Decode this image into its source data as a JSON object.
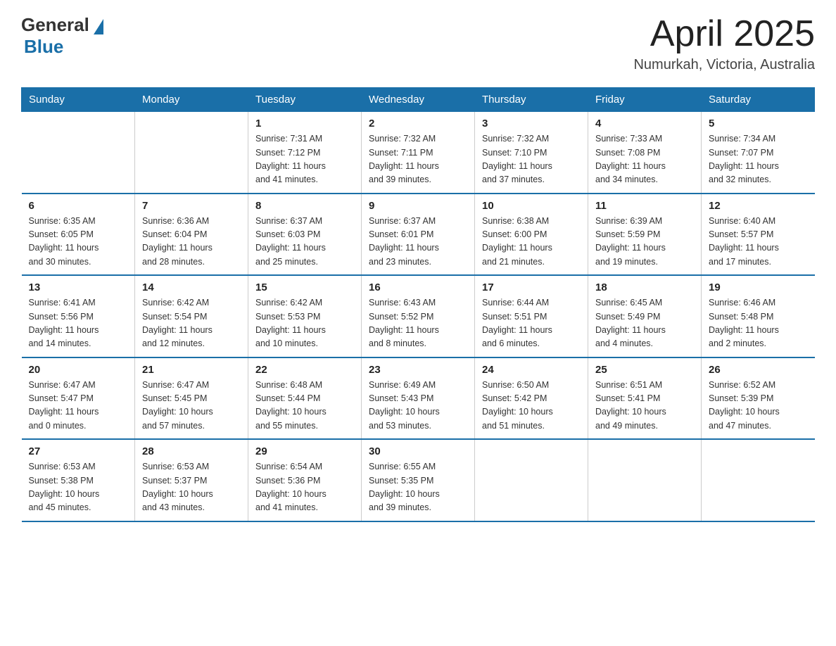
{
  "header": {
    "logo_general": "General",
    "logo_blue": "Blue",
    "title": "April 2025",
    "subtitle": "Numurkah, Victoria, Australia"
  },
  "weekdays": [
    "Sunday",
    "Monday",
    "Tuesday",
    "Wednesday",
    "Thursday",
    "Friday",
    "Saturday"
  ],
  "weeks": [
    [
      {
        "day": "",
        "info": ""
      },
      {
        "day": "",
        "info": ""
      },
      {
        "day": "1",
        "info": "Sunrise: 7:31 AM\nSunset: 7:12 PM\nDaylight: 11 hours\nand 41 minutes."
      },
      {
        "day": "2",
        "info": "Sunrise: 7:32 AM\nSunset: 7:11 PM\nDaylight: 11 hours\nand 39 minutes."
      },
      {
        "day": "3",
        "info": "Sunrise: 7:32 AM\nSunset: 7:10 PM\nDaylight: 11 hours\nand 37 minutes."
      },
      {
        "day": "4",
        "info": "Sunrise: 7:33 AM\nSunset: 7:08 PM\nDaylight: 11 hours\nand 34 minutes."
      },
      {
        "day": "5",
        "info": "Sunrise: 7:34 AM\nSunset: 7:07 PM\nDaylight: 11 hours\nand 32 minutes."
      }
    ],
    [
      {
        "day": "6",
        "info": "Sunrise: 6:35 AM\nSunset: 6:05 PM\nDaylight: 11 hours\nand 30 minutes."
      },
      {
        "day": "7",
        "info": "Sunrise: 6:36 AM\nSunset: 6:04 PM\nDaylight: 11 hours\nand 28 minutes."
      },
      {
        "day": "8",
        "info": "Sunrise: 6:37 AM\nSunset: 6:03 PM\nDaylight: 11 hours\nand 25 minutes."
      },
      {
        "day": "9",
        "info": "Sunrise: 6:37 AM\nSunset: 6:01 PM\nDaylight: 11 hours\nand 23 minutes."
      },
      {
        "day": "10",
        "info": "Sunrise: 6:38 AM\nSunset: 6:00 PM\nDaylight: 11 hours\nand 21 minutes."
      },
      {
        "day": "11",
        "info": "Sunrise: 6:39 AM\nSunset: 5:59 PM\nDaylight: 11 hours\nand 19 minutes."
      },
      {
        "day": "12",
        "info": "Sunrise: 6:40 AM\nSunset: 5:57 PM\nDaylight: 11 hours\nand 17 minutes."
      }
    ],
    [
      {
        "day": "13",
        "info": "Sunrise: 6:41 AM\nSunset: 5:56 PM\nDaylight: 11 hours\nand 14 minutes."
      },
      {
        "day": "14",
        "info": "Sunrise: 6:42 AM\nSunset: 5:54 PM\nDaylight: 11 hours\nand 12 minutes."
      },
      {
        "day": "15",
        "info": "Sunrise: 6:42 AM\nSunset: 5:53 PM\nDaylight: 11 hours\nand 10 minutes."
      },
      {
        "day": "16",
        "info": "Sunrise: 6:43 AM\nSunset: 5:52 PM\nDaylight: 11 hours\nand 8 minutes."
      },
      {
        "day": "17",
        "info": "Sunrise: 6:44 AM\nSunset: 5:51 PM\nDaylight: 11 hours\nand 6 minutes."
      },
      {
        "day": "18",
        "info": "Sunrise: 6:45 AM\nSunset: 5:49 PM\nDaylight: 11 hours\nand 4 minutes."
      },
      {
        "day": "19",
        "info": "Sunrise: 6:46 AM\nSunset: 5:48 PM\nDaylight: 11 hours\nand 2 minutes."
      }
    ],
    [
      {
        "day": "20",
        "info": "Sunrise: 6:47 AM\nSunset: 5:47 PM\nDaylight: 11 hours\nand 0 minutes."
      },
      {
        "day": "21",
        "info": "Sunrise: 6:47 AM\nSunset: 5:45 PM\nDaylight: 10 hours\nand 57 minutes."
      },
      {
        "day": "22",
        "info": "Sunrise: 6:48 AM\nSunset: 5:44 PM\nDaylight: 10 hours\nand 55 minutes."
      },
      {
        "day": "23",
        "info": "Sunrise: 6:49 AM\nSunset: 5:43 PM\nDaylight: 10 hours\nand 53 minutes."
      },
      {
        "day": "24",
        "info": "Sunrise: 6:50 AM\nSunset: 5:42 PM\nDaylight: 10 hours\nand 51 minutes."
      },
      {
        "day": "25",
        "info": "Sunrise: 6:51 AM\nSunset: 5:41 PM\nDaylight: 10 hours\nand 49 minutes."
      },
      {
        "day": "26",
        "info": "Sunrise: 6:52 AM\nSunset: 5:39 PM\nDaylight: 10 hours\nand 47 minutes."
      }
    ],
    [
      {
        "day": "27",
        "info": "Sunrise: 6:53 AM\nSunset: 5:38 PM\nDaylight: 10 hours\nand 45 minutes."
      },
      {
        "day": "28",
        "info": "Sunrise: 6:53 AM\nSunset: 5:37 PM\nDaylight: 10 hours\nand 43 minutes."
      },
      {
        "day": "29",
        "info": "Sunrise: 6:54 AM\nSunset: 5:36 PM\nDaylight: 10 hours\nand 41 minutes."
      },
      {
        "day": "30",
        "info": "Sunrise: 6:55 AM\nSunset: 5:35 PM\nDaylight: 10 hours\nand 39 minutes."
      },
      {
        "day": "",
        "info": ""
      },
      {
        "day": "",
        "info": ""
      },
      {
        "day": "",
        "info": ""
      }
    ]
  ]
}
